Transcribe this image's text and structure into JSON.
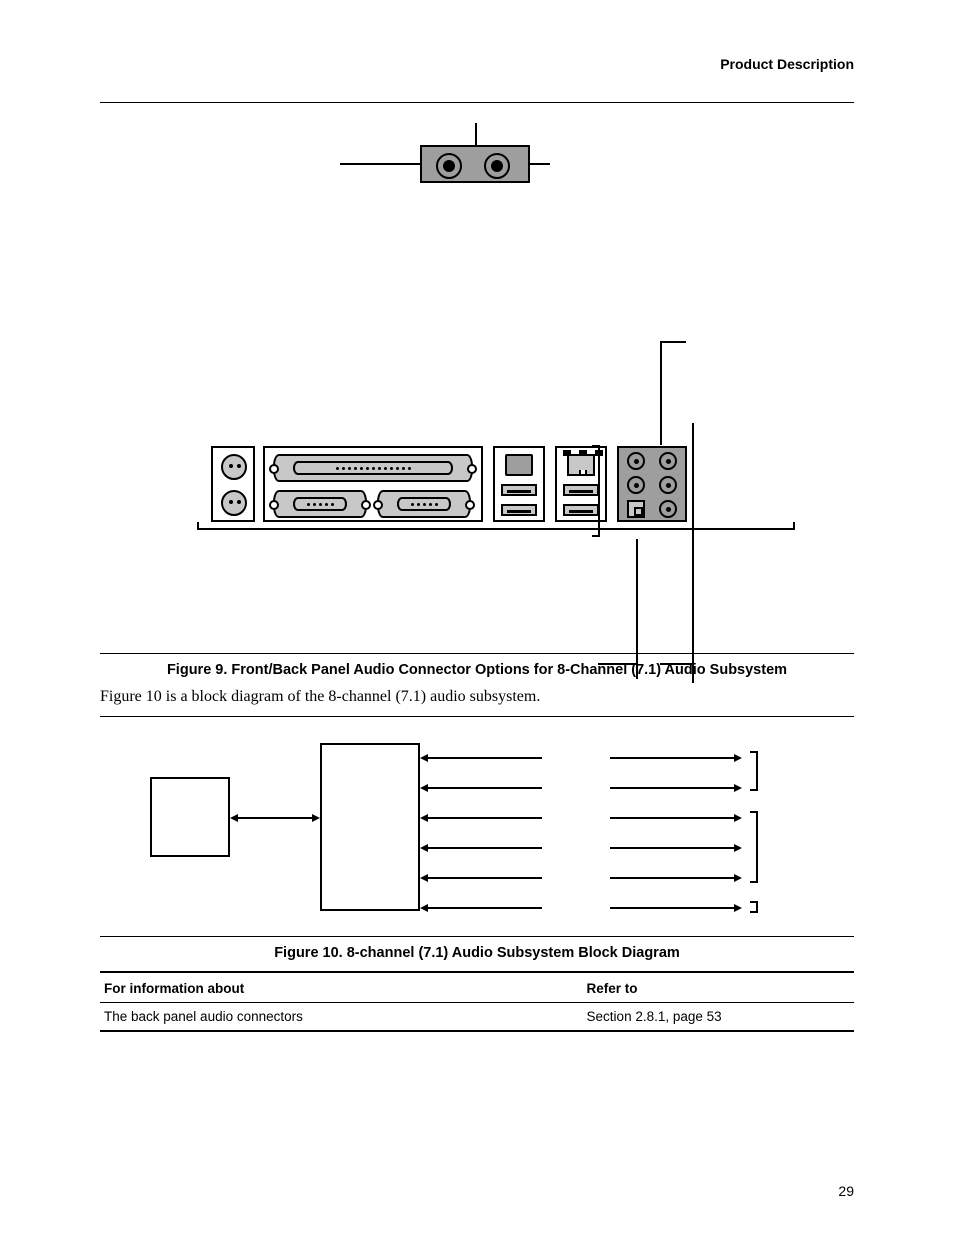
{
  "header": {
    "section": "Product Description"
  },
  "figure9": {
    "caption": "Figure 9.  Front/Back Panel Audio Connector Options for 8-Channel (7.1) Audio Subsystem"
  },
  "body": {
    "fig10_intro": "Figure 10 is a block diagram of the 8-channel (7.1) audio subsystem."
  },
  "figure10": {
    "caption": "Figure 10.  8-channel (7.1) Audio Subsystem Block Diagram"
  },
  "ref_table": {
    "headers": {
      "info": "For information about",
      "refer": "Refer to"
    },
    "rows": [
      {
        "info": "The back panel audio connectors",
        "refer": "Section 2.8.1, page 53"
      }
    ]
  },
  "page_number": "29"
}
